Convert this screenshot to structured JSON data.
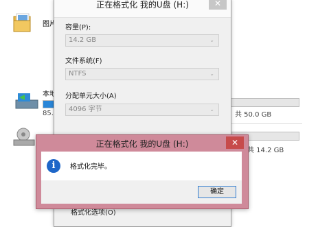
{
  "explorer": {
    "folder_label": "图片",
    "drive1": {
      "label": "本地",
      "size": "85.",
      "fill": 0.8
    },
    "right_text_1": "共 50.0 GB",
    "right_text_2": "共 14.2 GB",
    "icons": {
      "folder": "folder-icon",
      "drive": "windows-drive-icon",
      "usb": "usb-drive-icon"
    }
  },
  "format_dialog": {
    "title": "正在格式化 我的U盘 (H:)",
    "close": "✕",
    "capacity_label": "容量(P):",
    "capacity_value": "14.2 GB",
    "filesystem_label": "文件系统(F)",
    "filesystem_value": "NTFS",
    "allocation_label": "分配单元大小(A)",
    "allocation_value": "4096 字节",
    "bottom_label": "格式化选项(O)"
  },
  "done_dialog": {
    "title": "正在格式化 我的U盘 (H:)",
    "close": "✕",
    "message": "格式化完毕。",
    "ok_label": "确定",
    "icon": "info-icon",
    "accent": "#1e66c8"
  }
}
